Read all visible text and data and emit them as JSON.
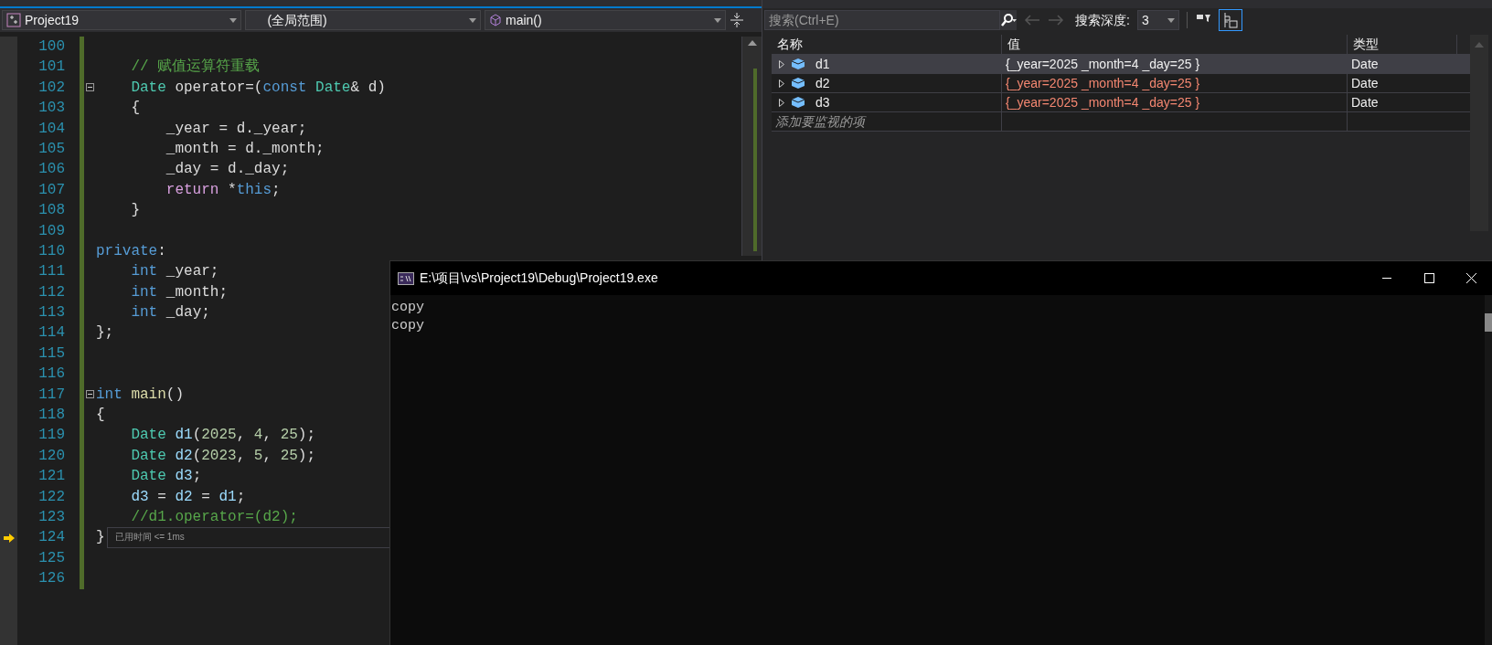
{
  "editor": {
    "toolbar": {
      "project": "Project19",
      "scope": "(全局范围)",
      "member": "main()"
    },
    "lines": [
      {
        "number": "100",
        "current": false,
        "fold": false
      },
      {
        "number": "101",
        "current": false,
        "fold": false,
        "tokens": [
          {
            "text": "    // 赋值运算符重载",
            "kind": "comment"
          }
        ]
      },
      {
        "number": "102",
        "current": false,
        "fold": true,
        "tokens": [
          {
            "text": "    Date",
            "kind": "type"
          },
          {
            "text": " operator=(",
            "kind": "plain"
          },
          {
            "text": "const",
            "kind": "keyword"
          },
          {
            "text": " Date",
            "kind": "type"
          },
          {
            "text": "& d)",
            "kind": "plain"
          }
        ]
      },
      {
        "number": "103",
        "current": false,
        "fold": false,
        "tokens": [
          {
            "text": "    {",
            "kind": "plain"
          }
        ]
      },
      {
        "number": "104",
        "current": false,
        "fold": false,
        "tokens": [
          {
            "text": "        _year = d._year;",
            "kind": "plain"
          }
        ]
      },
      {
        "number": "105",
        "current": false,
        "fold": false,
        "tokens": [
          {
            "text": "        _month = d._month;",
            "kind": "plain"
          }
        ]
      },
      {
        "number": "106",
        "current": false,
        "fold": false,
        "tokens": [
          {
            "text": "        _day = d._day;",
            "kind": "plain"
          }
        ]
      },
      {
        "number": "107",
        "current": false,
        "fold": false,
        "tokens": [
          {
            "text": "        return",
            "kind": "control"
          },
          {
            "text": " *",
            "kind": "plain"
          },
          {
            "text": "this",
            "kind": "keyword"
          },
          {
            "text": ";",
            "kind": "plain"
          }
        ]
      },
      {
        "number": "108",
        "current": false,
        "fold": false,
        "tokens": [
          {
            "text": "    }",
            "kind": "plain"
          }
        ]
      },
      {
        "number": "109",
        "current": false,
        "fold": false
      },
      {
        "number": "110",
        "current": false,
        "fold": false,
        "tokens": [
          {
            "text": "private",
            "kind": "keyword"
          },
          {
            "text": ":",
            "kind": "plain"
          }
        ]
      },
      {
        "number": "111",
        "current": false,
        "fold": false,
        "tokens": [
          {
            "text": "    int",
            "kind": "keyword"
          },
          {
            "text": " _year;",
            "kind": "plain"
          }
        ]
      },
      {
        "number": "112",
        "current": false,
        "fold": false,
        "tokens": [
          {
            "text": "    int",
            "kind": "keyword"
          },
          {
            "text": " _month;",
            "kind": "plain"
          }
        ]
      },
      {
        "number": "113",
        "current": false,
        "fold": false,
        "tokens": [
          {
            "text": "    int",
            "kind": "keyword"
          },
          {
            "text": " _day;",
            "kind": "plain"
          }
        ]
      },
      {
        "number": "114",
        "current": false,
        "fold": false,
        "tokens": [
          {
            "text": "};",
            "kind": "plain"
          }
        ]
      },
      {
        "number": "115",
        "current": false,
        "fold": false
      },
      {
        "number": "116",
        "current": false,
        "fold": false
      },
      {
        "number": "117",
        "current": false,
        "fold": true,
        "tokens": [
          {
            "text": "int",
            "kind": "keyword"
          },
          {
            "text": " main",
            "kind": "function"
          },
          {
            "text": "()",
            "kind": "plain"
          }
        ]
      },
      {
        "number": "118",
        "current": false,
        "fold": false,
        "tokens": [
          {
            "text": "{",
            "kind": "plain"
          }
        ]
      },
      {
        "number": "119",
        "current": false,
        "fold": false,
        "tokens": [
          {
            "text": "    Date",
            "kind": "type"
          },
          {
            "text": " d1",
            "kind": "variable"
          },
          {
            "text": "(",
            "kind": "plain"
          },
          {
            "text": "2025",
            "kind": "number"
          },
          {
            "text": ", ",
            "kind": "plain"
          },
          {
            "text": "4",
            "kind": "number"
          },
          {
            "text": ", ",
            "kind": "plain"
          },
          {
            "text": "25",
            "kind": "number"
          },
          {
            "text": ");",
            "kind": "plain"
          }
        ]
      },
      {
        "number": "120",
        "current": false,
        "fold": false,
        "tokens": [
          {
            "text": "    Date",
            "kind": "type"
          },
          {
            "text": " d2",
            "kind": "variable"
          },
          {
            "text": "(",
            "kind": "plain"
          },
          {
            "text": "2023",
            "kind": "number"
          },
          {
            "text": ", ",
            "kind": "plain"
          },
          {
            "text": "5",
            "kind": "number"
          },
          {
            "text": ", ",
            "kind": "plain"
          },
          {
            "text": "25",
            "kind": "number"
          },
          {
            "text": ");",
            "kind": "plain"
          }
        ]
      },
      {
        "number": "121",
        "current": false,
        "fold": false,
        "tokens": [
          {
            "text": "    Date",
            "kind": "type"
          },
          {
            "text": " d3",
            "kind": "variable"
          },
          {
            "text": ";",
            "kind": "plain"
          }
        ]
      },
      {
        "number": "122",
        "current": false,
        "fold": false,
        "tokens": [
          {
            "text": "    d3",
            "kind": "variable"
          },
          {
            "text": " = ",
            "kind": "plain"
          },
          {
            "text": "d2",
            "kind": "variable"
          },
          {
            "text": " = ",
            "kind": "plain"
          },
          {
            "text": "d1",
            "kind": "variable"
          },
          {
            "text": ";",
            "kind": "plain"
          }
        ]
      },
      {
        "number": "123",
        "current": false,
        "fold": false,
        "tokens": [
          {
            "text": "    //d1.operator=(d2);",
            "kind": "comment"
          }
        ]
      },
      {
        "number": "124",
        "current": true,
        "fold": false,
        "tokens": [
          {
            "text": "}",
            "kind": "plain"
          }
        ],
        "perf_tip": "已用时间 <= 1ms"
      },
      {
        "number": "125",
        "current": false,
        "fold": false
      },
      {
        "number": "126",
        "current": false,
        "fold": false
      }
    ]
  },
  "watch": {
    "search": {
      "placeholder": "搜索(Ctrl+E)"
    },
    "depth_label": "搜索深度:",
    "depth": "3",
    "columns": [
      "名称",
      "值",
      "类型"
    ],
    "rows": [
      {
        "name": "d1",
        "value": "{_year=2025 _month=4 _day=25 }",
        "type": "Date",
        "changed": false,
        "selected": true
      },
      {
        "name": "d2",
        "value": "{_year=2025 _month=4 _day=25 }",
        "type": "Date",
        "changed": true,
        "selected": false
      },
      {
        "name": "d3",
        "value": "{_year=2025 _month=4 _day=25 }",
        "type": "Date",
        "changed": true,
        "selected": false
      }
    ],
    "add_item": "添加要监视的项"
  },
  "console": {
    "title": "E:\\项目\\vs\\Project19\\Debug\\Project19.exe",
    "output": [
      "copy",
      "copy"
    ]
  }
}
